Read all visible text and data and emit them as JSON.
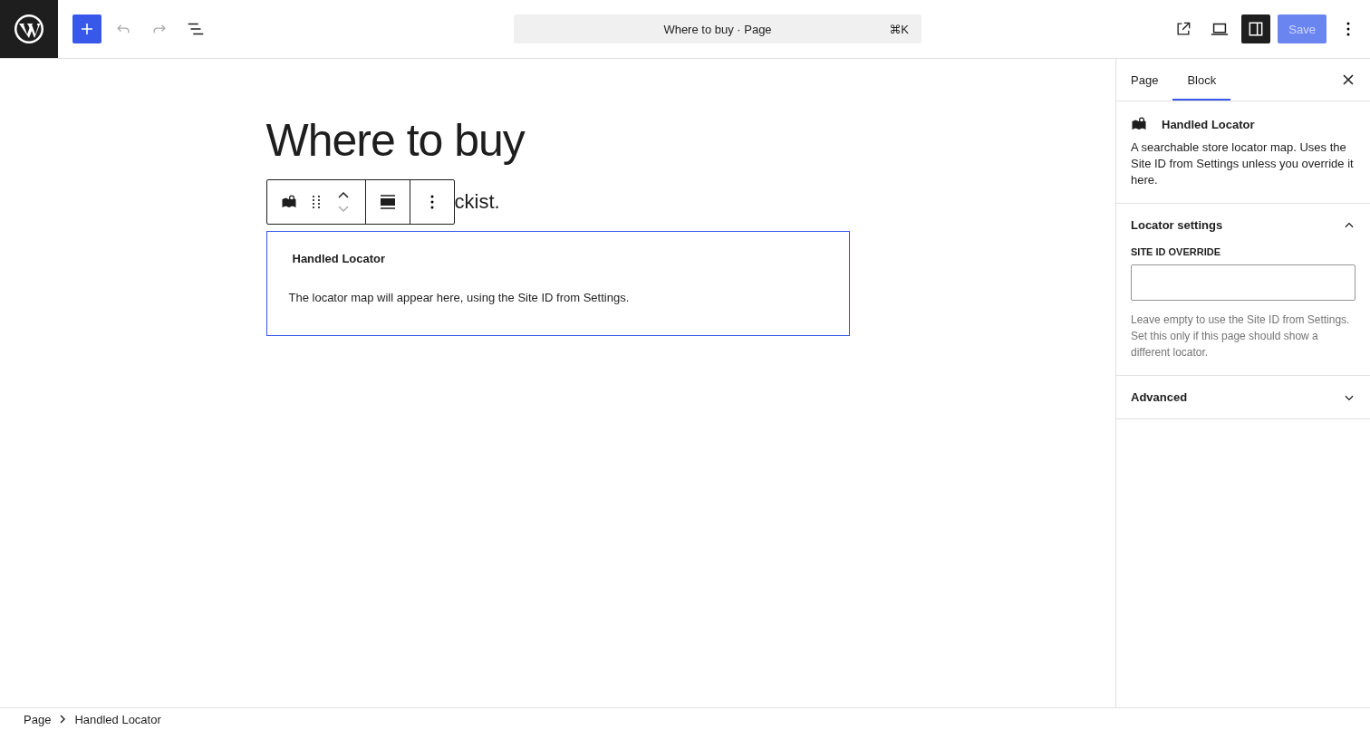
{
  "header": {
    "command_bar": {
      "title": "Where to buy · Page",
      "shortcut": "⌘K"
    },
    "undo_disabled": true,
    "redo_disabled": true,
    "settings_pressed": true,
    "save": {
      "label": "Save",
      "disabled": true
    }
  },
  "canvas": {
    "title": "Where to buy",
    "paragraph_visible": "ckist.",
    "block": {
      "heading": "Handled Locator",
      "message": "The locator map will appear here, using the Site ID from Settings.",
      "selected": true
    }
  },
  "sidebar": {
    "tabs": [
      {
        "label": "Page",
        "selected": false
      },
      {
        "label": "Block",
        "selected": true
      }
    ],
    "block_card": {
      "title": "Handled Locator",
      "description": "A searchable store locator map. Uses the Site ID from Settings unless you override it here."
    },
    "panels": [
      {
        "title": "Locator settings",
        "expanded": true,
        "field": {
          "label": "SITE ID OVERRIDE",
          "help": "Leave empty to use the Site ID from Settings. Set this only if this page should show a different locator."
        }
      },
      {
        "title": "Advanced",
        "expanded": false
      }
    ]
  },
  "breadcrumbs": [
    "Page",
    "Handled Locator"
  ]
}
